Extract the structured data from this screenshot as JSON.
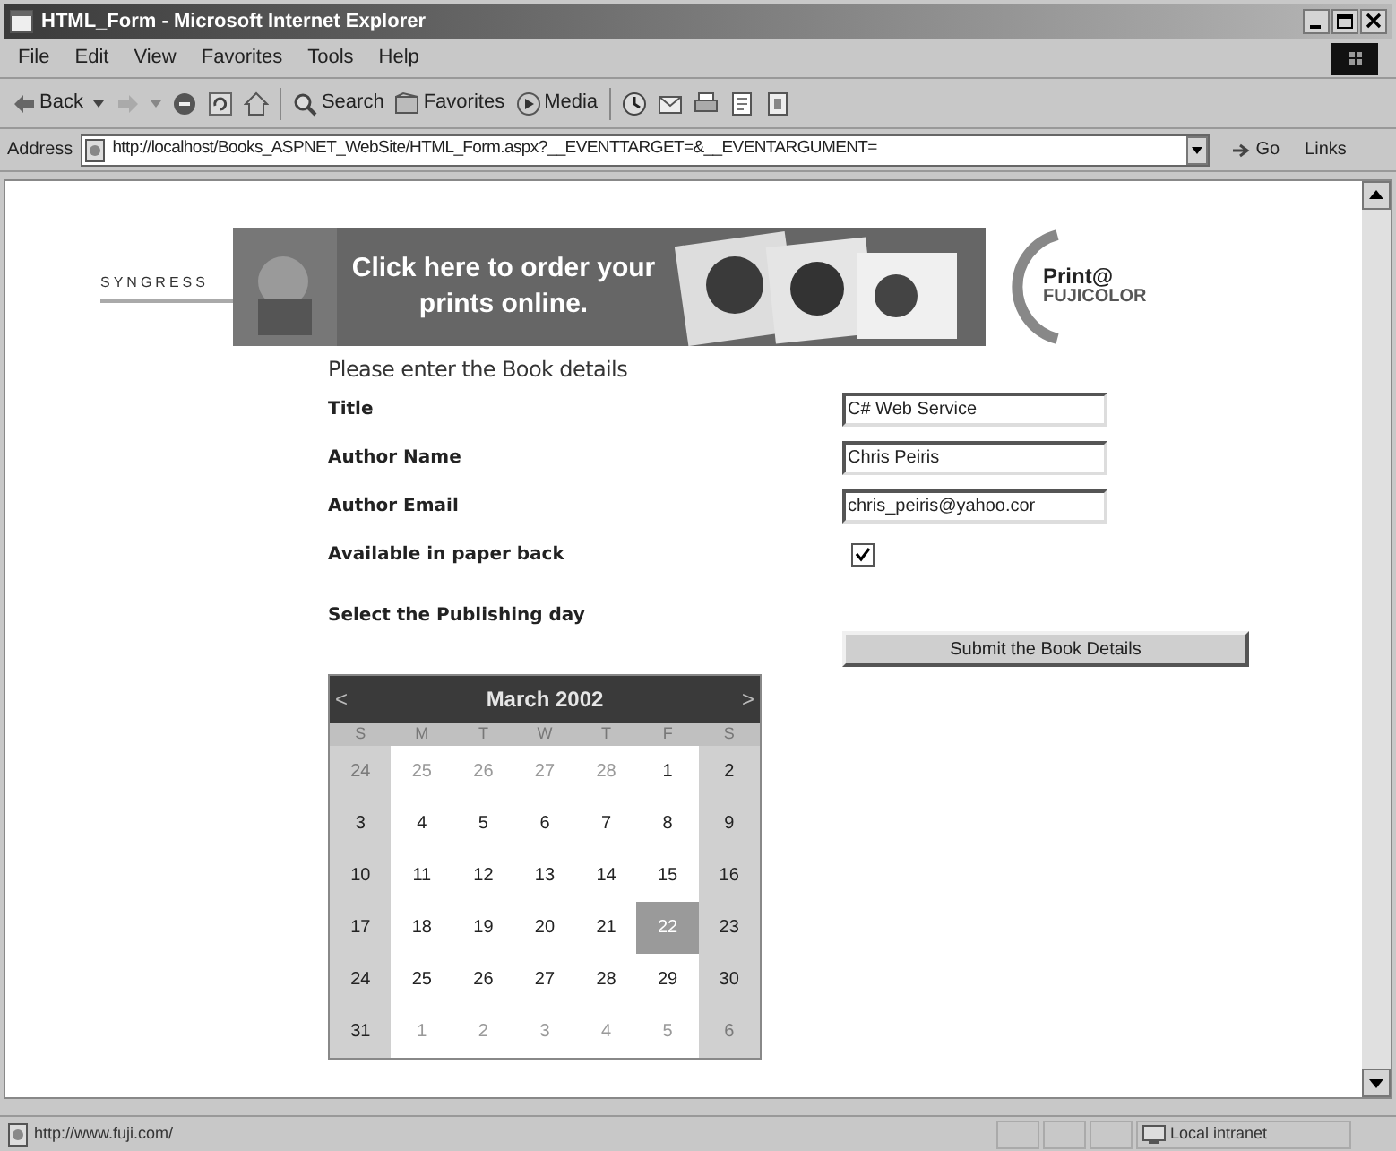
{
  "window": {
    "title": "HTML_Form - Microsoft Internet Explorer"
  },
  "menu": [
    "File",
    "Edit",
    "View",
    "Favorites",
    "Tools",
    "Help"
  ],
  "toolbar": [
    {
      "kind": "back",
      "label": "Back"
    },
    {
      "kind": "forward"
    },
    {
      "kind": "stop"
    },
    {
      "kind": "refresh"
    },
    {
      "kind": "home"
    },
    {
      "kind": "search",
      "label": "Search"
    },
    {
      "kind": "favorites",
      "label": "Favorites"
    },
    {
      "kind": "media",
      "label": "Media"
    },
    {
      "kind": "history"
    },
    {
      "kind": "mail"
    },
    {
      "kind": "print"
    },
    {
      "kind": "edit"
    },
    {
      "kind": "discuss"
    }
  ],
  "address": {
    "label": "Address",
    "value": "http://localhost/Books_ASPNET_WebSite/HTML_Form.aspx?__EVENTTARGET=&__EVENTARGUMENT=",
    "go": "Go",
    "links": "Links"
  },
  "page": {
    "logo": "SYNGRESS",
    "banner": {
      "text": "Click here to order your prints online.",
      "brand_top": "Print@",
      "brand_bottom": "FUJICOLOR"
    },
    "heading": "Please enter the Book details",
    "fields": [
      {
        "kind": "text",
        "label": "Title",
        "value": "C# Web Service"
      },
      {
        "kind": "text",
        "label": "Author Name",
        "value": "Chris Peiris"
      },
      {
        "kind": "text",
        "label": "Author Email",
        "value": "chris_peiris@yahoo.cor"
      },
      {
        "kind": "checkbox",
        "label": "Available in paper back",
        "checked": true
      }
    ],
    "date_label": "Select the Publishing day",
    "submit": "Submit the Book Details",
    "calendar": {
      "prev": "<",
      "month": "March 2002",
      "next": ">",
      "weekdays": [
        "S",
        "M",
        "T",
        "W",
        "T",
        "F",
        "S"
      ],
      "weeks": [
        [
          {
            "day": "24",
            "other_month": true,
            "selected": false
          },
          {
            "day": "25",
            "other_month": true,
            "selected": false
          },
          {
            "day": "26",
            "other_month": true,
            "selected": false
          },
          {
            "day": "27",
            "other_month": true,
            "selected": false
          },
          {
            "day": "28",
            "other_month": true,
            "selected": false
          },
          {
            "day": "1",
            "other_month": false,
            "selected": false
          },
          {
            "day": "2",
            "other_month": false,
            "selected": false
          }
        ],
        [
          {
            "day": "3",
            "other_month": false,
            "selected": false
          },
          {
            "day": "4",
            "other_month": false,
            "selected": false
          },
          {
            "day": "5",
            "other_month": false,
            "selected": false
          },
          {
            "day": "6",
            "other_month": false,
            "selected": false
          },
          {
            "day": "7",
            "other_month": false,
            "selected": false
          },
          {
            "day": "8",
            "other_month": false,
            "selected": false
          },
          {
            "day": "9",
            "other_month": false,
            "selected": false
          }
        ],
        [
          {
            "day": "10",
            "other_month": false,
            "selected": false
          },
          {
            "day": "11",
            "other_month": false,
            "selected": false
          },
          {
            "day": "12",
            "other_month": false,
            "selected": false
          },
          {
            "day": "13",
            "other_month": false,
            "selected": false
          },
          {
            "day": "14",
            "other_month": false,
            "selected": false
          },
          {
            "day": "15",
            "other_month": false,
            "selected": false
          },
          {
            "day": "16",
            "other_month": false,
            "selected": false
          }
        ],
        [
          {
            "day": "17",
            "other_month": false,
            "selected": false
          },
          {
            "day": "18",
            "other_month": false,
            "selected": false
          },
          {
            "day": "19",
            "other_month": false,
            "selected": false
          },
          {
            "day": "20",
            "other_month": false,
            "selected": false
          },
          {
            "day": "21",
            "other_month": false,
            "selected": false
          },
          {
            "day": "22",
            "other_month": false,
            "selected": true
          },
          {
            "day": "23",
            "other_month": false,
            "selected": false
          }
        ],
        [
          {
            "day": "24",
            "other_month": false,
            "selected": false
          },
          {
            "day": "25",
            "other_month": false,
            "selected": false
          },
          {
            "day": "26",
            "other_month": false,
            "selected": false
          },
          {
            "day": "27",
            "other_month": false,
            "selected": false
          },
          {
            "day": "28",
            "other_month": false,
            "selected": false
          },
          {
            "day": "29",
            "other_month": false,
            "selected": false
          },
          {
            "day": "30",
            "other_month": false,
            "selected": false
          }
        ],
        [
          {
            "day": "31",
            "other_month": false,
            "selected": false
          },
          {
            "day": "1",
            "other_month": true,
            "selected": false
          },
          {
            "day": "2",
            "other_month": true,
            "selected": false
          },
          {
            "day": "3",
            "other_month": true,
            "selected": false
          },
          {
            "day": "4",
            "other_month": true,
            "selected": false
          },
          {
            "day": "5",
            "other_month": true,
            "selected": false
          },
          {
            "day": "6",
            "other_month": true,
            "selected": false
          }
        ]
      ]
    }
  },
  "status_bar": {
    "url": "http://www.fuji.com/",
    "zone": "Local intranet"
  }
}
